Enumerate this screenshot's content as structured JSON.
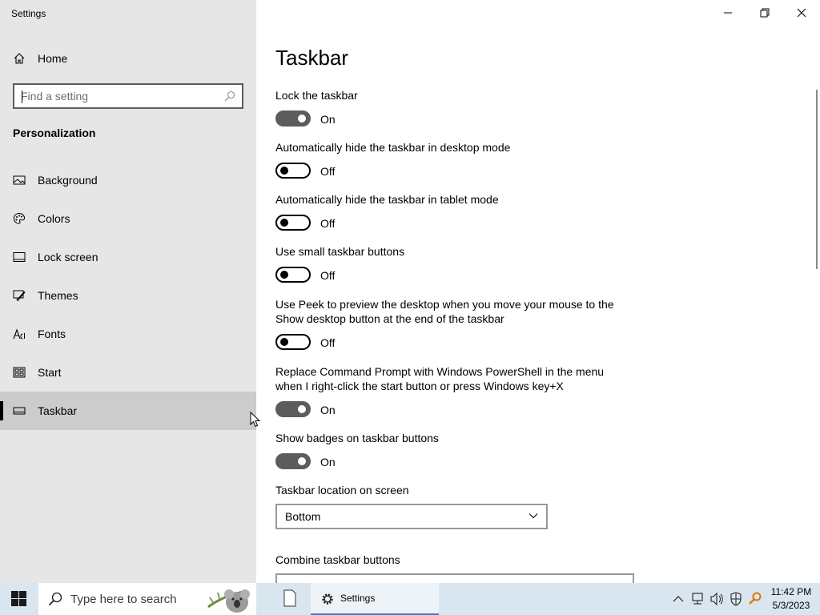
{
  "window": {
    "title": "Settings",
    "controls": [
      "minimize-icon",
      "restore-icon",
      "close-icon"
    ]
  },
  "sidebar": {
    "home_label": "Home",
    "search_placeholder": "Find a setting",
    "section_title": "Personalization",
    "items": [
      {
        "label": "Background",
        "icon": "picture-icon"
      },
      {
        "label": "Colors",
        "icon": "palette-icon"
      },
      {
        "label": "Lock screen",
        "icon": "lock-screen-icon"
      },
      {
        "label": "Themes",
        "icon": "brush-icon"
      },
      {
        "label": "Fonts",
        "icon": "font-icon"
      },
      {
        "label": "Start",
        "icon": "start-tiles-icon"
      },
      {
        "label": "Taskbar",
        "icon": "taskbar-icon",
        "selected": true
      }
    ]
  },
  "main": {
    "title": "Taskbar",
    "settings": [
      {
        "label": "Lock the taskbar",
        "state": "On"
      },
      {
        "label": "Automatically hide the taskbar in desktop mode",
        "state": "Off"
      },
      {
        "label": "Automatically hide the taskbar in tablet mode",
        "state": "Off"
      },
      {
        "label": "Use small taskbar buttons",
        "state": "Off"
      },
      {
        "label": "Use Peek to preview the desktop when you move your mouse to the Show desktop button at the end of the taskbar",
        "state": "Off"
      },
      {
        "label": "Replace Command Prompt with Windows PowerShell in the menu when I right-click the start button or press Windows key+X",
        "state": "On"
      },
      {
        "label": "Show badges on taskbar buttons",
        "state": "On"
      }
    ],
    "location_label": "Taskbar location on screen",
    "location_value": "Bottom",
    "combine_label": "Combine taskbar buttons"
  },
  "taskbar": {
    "search_text": "Type here to search",
    "settings_app_label": "Settings",
    "clock_time": "11:42 PM",
    "clock_date": "5/3/2023"
  },
  "colors": {
    "sidebar_bg": "#e6e6e6",
    "selected_bg": "#cccccc",
    "toggle_on": "#5c5c5c",
    "taskbar_bg": "#d9e6f0"
  }
}
